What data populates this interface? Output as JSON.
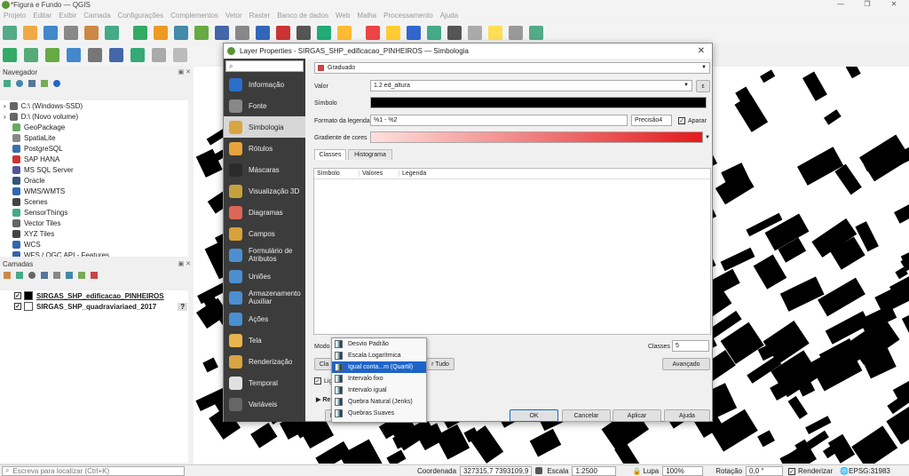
{
  "window": {
    "title": "*Figura e Fundo — QGIS"
  },
  "menubar": [
    "Projeto",
    "Editar",
    "Exibir",
    "Camada",
    "Configurações",
    "Complementos",
    "Vetor",
    "Raster",
    "Banco de dados",
    "Web",
    "Malha",
    "Processamento",
    "Ajuda"
  ],
  "navigator": {
    "title": "Navegador",
    "items": [
      "C:\\ (Windows-SSD)",
      "D:\\ (Novo volume)",
      "GeoPackage",
      "SpatiaLite",
      "PostgreSQL",
      "SAP HANA",
      "MS SQL Server",
      "Oracle",
      "WMS/WMTS",
      "Scenes",
      "SensorThings",
      "Vector Tiles",
      "XYZ Tiles",
      "WCS",
      "WFS / OGC API - Features"
    ]
  },
  "layers": {
    "title": "Camadas",
    "items": [
      {
        "name": "SIRGAS_SHP_edificacao_PINHEIROS",
        "color": "#000000",
        "checked": true
      },
      {
        "name": "SIRGAS_SHP_quadraviariaed_2017",
        "color": "#ffffff",
        "checked": true
      }
    ]
  },
  "dialog": {
    "title": "Layer Properties - SIRGAS_SHP_edificacao_PINHEIROS — Simbologia",
    "sidebar": [
      "Informação",
      "Fonte",
      "Simbologia",
      "Rótulos",
      "Máscaras",
      "Visualização 3D",
      "Diagramas",
      "Campos",
      "Formulário de Atributos",
      "Uniões",
      "Armazenamento Auxiliar",
      "Ações",
      "Tela",
      "Renderização",
      "Temporal",
      "Variáveis"
    ],
    "renderer": "Graduado",
    "valor_label": "Valor",
    "valor": "1.2  ed_altura",
    "simbolo_label": "Símbolo",
    "formato_label": "Formato da legenda",
    "formato_value": "%1 - %2",
    "precisao": "Precisão4",
    "aparar": "Aparar",
    "gradiente_label": "Gradiente de cores",
    "tabs": [
      "Classes",
      "Histograma"
    ],
    "columns": [
      "Símbolo",
      "Valores",
      "Legenda"
    ],
    "modo_label": "Modo",
    "classes_label": "Classes",
    "classes_value": "5",
    "classify_short": "Cla",
    "delete_all": "r Tudo",
    "advanced": "Avançado",
    "link_short": "Lig",
    "render_short": "Re",
    "style_short": "Es",
    "buttons": {
      "ok": "OK",
      "cancel": "Cancelar",
      "apply": "Aplicar",
      "help": "Ajuda"
    }
  },
  "mode_menu": [
    "Desvio Padrão",
    "Escala Logarítmica",
    "Igual conta...m (Quartil)",
    "Intervalo fixo",
    "Intervalo igual",
    "Quebra Natural (Jenks)",
    "Quebras Suaves"
  ],
  "mode_menu_selected": 2,
  "statusbar": {
    "search_placeholder": "Escreva para localizar (Ctrl+K)",
    "coord_label": "Coordenada",
    "coord": "327315,7  7393109,9",
    "scale_label": "Escala",
    "scale": "1:2500",
    "zoom_label": "Lupa",
    "zoom": "100%",
    "rotation_label": "Rotação",
    "rotation": "0,0 °",
    "render_label": "Renderizar",
    "crs": "EPSG:31983"
  },
  "colors": {
    "accent": "#1e64c8",
    "gradient_start": "#fde0dd",
    "gradient_end": "#e31a1c"
  }
}
